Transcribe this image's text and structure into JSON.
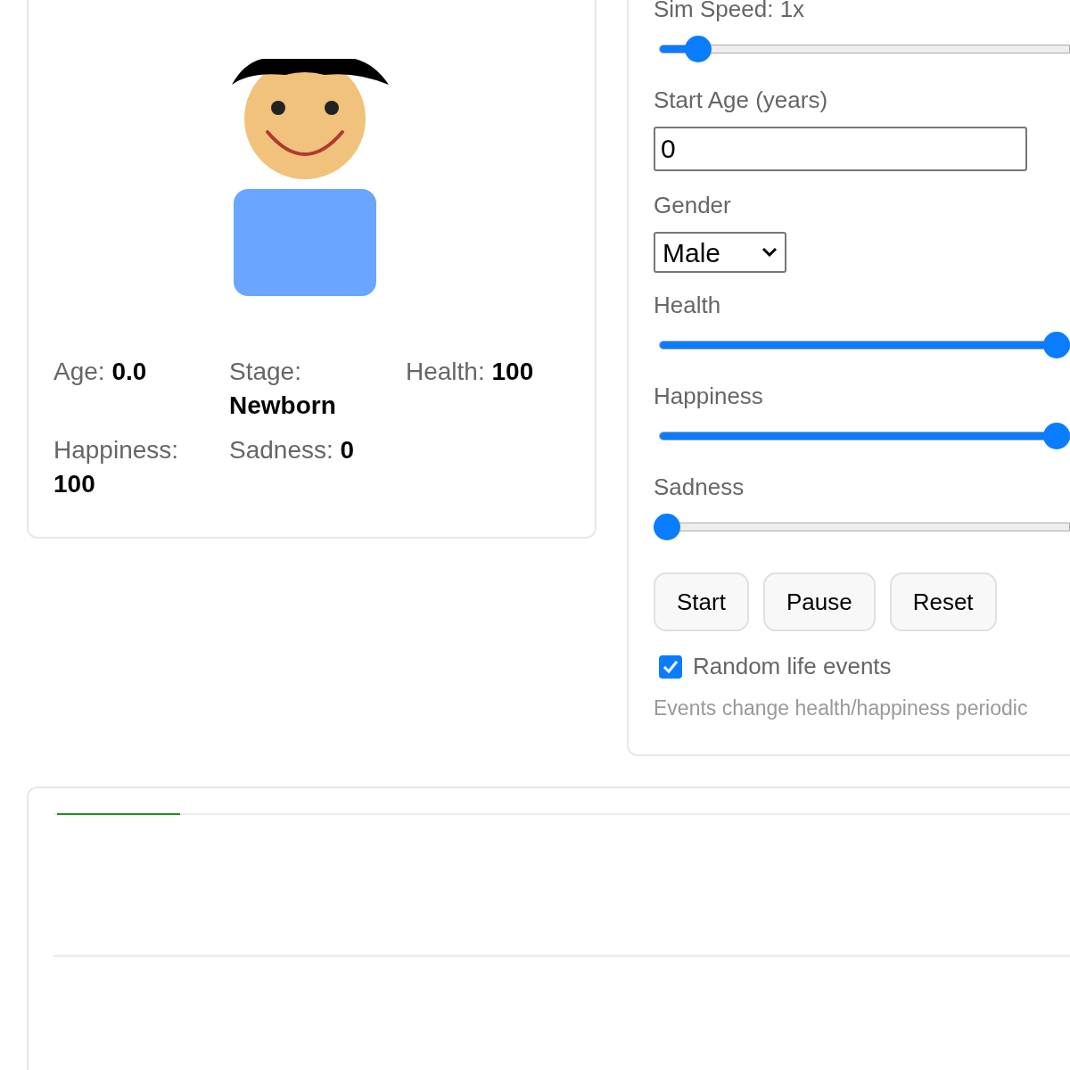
{
  "stats": [
    {
      "label": "Age:",
      "value": "0.0"
    },
    {
      "label": "Stage:",
      "value": "Newborn"
    },
    {
      "label": "Health:",
      "value": "100"
    },
    {
      "label": "Happiness:",
      "value": "100"
    },
    {
      "label": "Sadness:",
      "value": "0"
    }
  ],
  "controls": [
    {
      "kind": "slider",
      "label": "Sim Speed: 1x",
      "level": 0.08
    },
    {
      "kind": "number",
      "label": "Start Age (years)",
      "value": "0"
    },
    {
      "kind": "select",
      "label": "Gender",
      "value": "Male"
    },
    {
      "kind": "slider",
      "label": "Health",
      "level": 1
    },
    {
      "kind": "slider",
      "label": "Happiness",
      "level": 1
    },
    {
      "kind": "slider",
      "label": "Sadness",
      "level": 0
    }
  ],
  "buttons": [
    "Start",
    "Pause",
    "Reset"
  ],
  "random_events": {
    "label": "Random life events",
    "checked": true
  },
  "hint": "Events change health/happiness periodic"
}
